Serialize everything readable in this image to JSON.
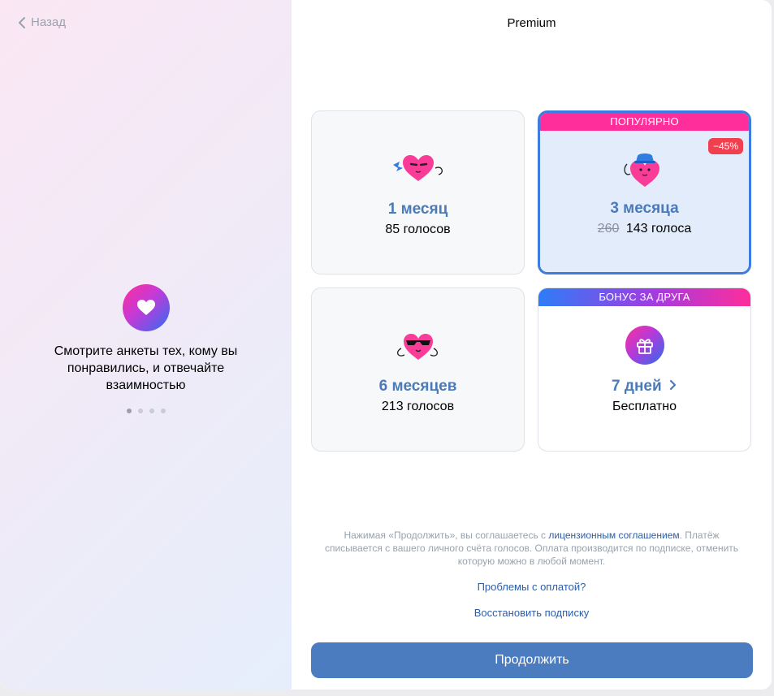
{
  "back": {
    "label": "Назад"
  },
  "feature": {
    "text": "Смотрите анкеты тех, кому вы понравились, и отвечайте взаимностью",
    "icon": "heart-icon",
    "dots": 4,
    "active_dot": 1
  },
  "header": {
    "title": "Premium"
  },
  "plans": [
    {
      "name": "1 месяц",
      "price": "85 голосов",
      "icon": "heart-with-bird-icon"
    },
    {
      "name": "3 месяца",
      "price": "143 голоса",
      "old_price": "260",
      "banner": "ПОПУЛЯРНО",
      "discount": "−45%",
      "selected": true,
      "icon": "heart-with-hat-icon"
    },
    {
      "name": "6 месяцев",
      "price": "213 голосов",
      "icon": "heart-with-sunglasses-icon"
    },
    {
      "name": "7 дней",
      "price": "Бесплатно",
      "banner": "БОНУС ЗА ДРУГА",
      "icon": "gift-icon"
    }
  ],
  "legal": {
    "prefix": "Нажимая «Продолжить», вы соглашаетесь с ",
    "link": "лицензионным соглашением",
    "suffix": ". Платёж списывается с вашего личного счёта голосов. Оплата производится по подписке, отменить которую можно в любой момент."
  },
  "payment_problems": "Проблемы с оплатой?",
  "restore": "Восстановить подписку",
  "continue_label": "Продолжить",
  "colors": {
    "accent": "#4a7cbf",
    "pink": "#ff2e9a",
    "selected_border": "#3f7ce0",
    "discount": "#f0404f"
  }
}
